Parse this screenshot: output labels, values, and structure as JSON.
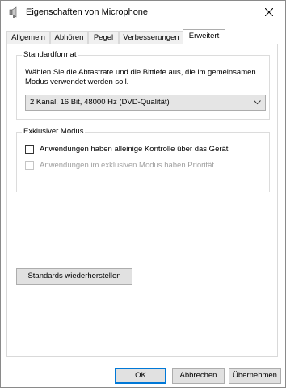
{
  "window": {
    "title": "Eigenschaften von Microphone",
    "title_icon": "speaker-icon",
    "close_icon": "close-icon"
  },
  "tabs": [
    {
      "label": "Allgemein",
      "active": false
    },
    {
      "label": "Abhören",
      "active": false
    },
    {
      "label": "Pegel",
      "active": false
    },
    {
      "label": "Verbesserungen",
      "active": false
    },
    {
      "label": "Erweitert",
      "active": true
    }
  ],
  "standardformat": {
    "legend": "Standardformat",
    "description": "Wählen Sie die Abtastrate und die Bittiefe aus, die im gemeinsamen Modus verwendet werden soll.",
    "selected_value": "2 Kanal, 16 Bit, 48000 Hz (DVD-Qualität)"
  },
  "exclusive": {
    "legend": "Exklusiver Modus",
    "option1": {
      "label": "Anwendungen haben alleinige Kontrolle über das Gerät",
      "checked": false,
      "enabled": true
    },
    "option2": {
      "label": "Anwendungen im exklusiven Modus haben Priorität",
      "checked": false,
      "enabled": false
    }
  },
  "restore_button": "Standards wiederherstellen",
  "footer": {
    "ok": "OK",
    "cancel": "Abbrechen",
    "apply": "Übernehmen"
  },
  "colors": {
    "default_button_border": "#0078d7",
    "button_face": "#e1e1e1",
    "disabled_text": "#a0a0a0"
  }
}
